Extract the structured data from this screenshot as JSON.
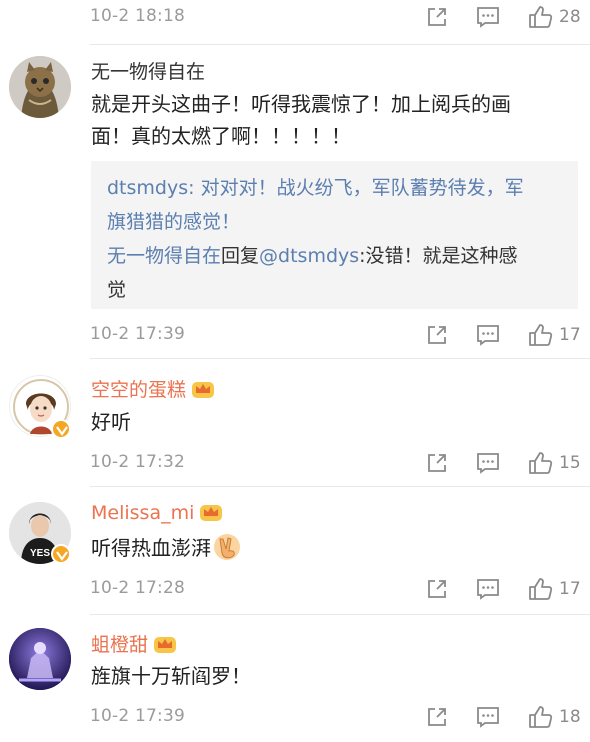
{
  "comments": [
    {
      "time": "10-2 18:18",
      "likes": "28"
    },
    {
      "username": "无一物得自在",
      "text_line1": "就是开头这曲子！听得我震惊了！加上阅兵的画",
      "text_line2": "面！真的太燃了啊！！！！！",
      "quote": {
        "reply1_user": "dtsmdys",
        "reply1_text_a": ": 对对对！战火纷飞，军队蓄势待发，军",
        "reply1_text_b": "旗猎猎的感觉！",
        "reply2_user": "无一物得自在",
        "reply2_mid": "回复",
        "reply2_mention": "@dtsmdys",
        "reply2_text_a": ":没错！就是这种感",
        "reply2_text_b": "觉"
      },
      "time": "10-2 17:39",
      "likes": "17"
    },
    {
      "username": "空空的蛋糕",
      "text": "好听",
      "time": "10-2 17:32",
      "likes": "15"
    },
    {
      "username": "Melissa_mi",
      "text": "听得热血澎湃",
      "emoji": "victory-hand-emoji",
      "avatar_shirt_text": "YES",
      "time": "10-2 17:28",
      "likes": "17"
    },
    {
      "username": "蛆橙甜",
      "text": "旌旗十万斩阎罗！",
      "time": "10-2 17:39",
      "likes": "18"
    }
  ],
  "colors": {
    "vip_name": "#eb7350",
    "link": "#5b7fb0",
    "meta": "#9b9b9b",
    "badge": "#f5a623"
  },
  "icons": [
    "share-icon",
    "comment-icon",
    "like-icon",
    "vip-crown-icon",
    "verified-badge-icon"
  ]
}
